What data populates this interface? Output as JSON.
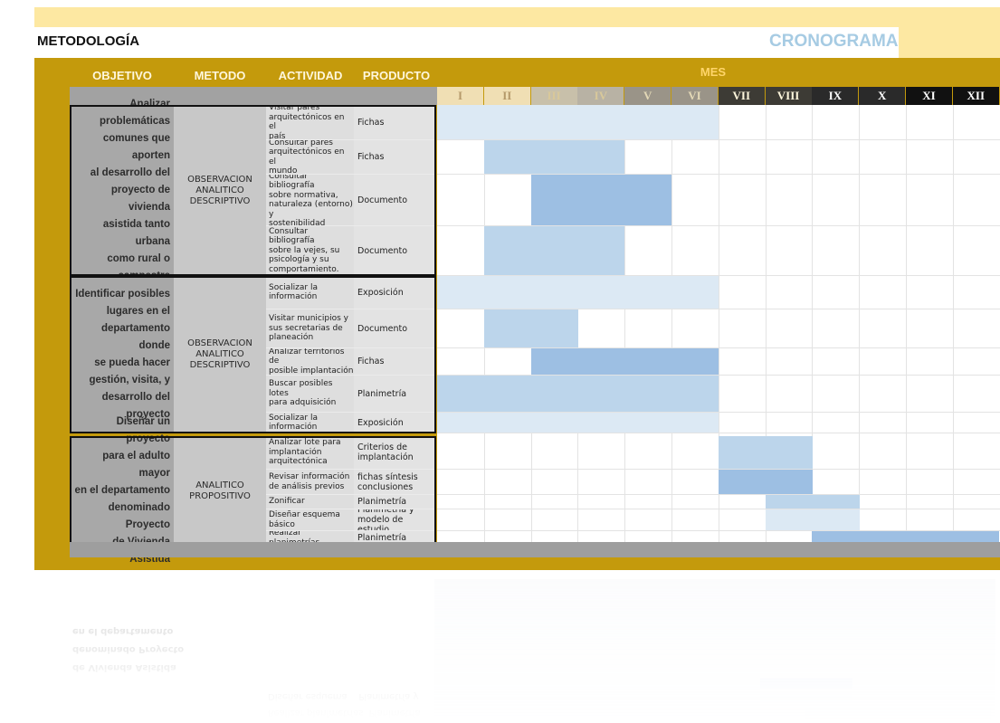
{
  "title_left": "METODOLOGÍA",
  "title_right": "CRONOGRAMA",
  "headers": {
    "objetivo": "OBJETIVO",
    "metodo": "METODO",
    "actividad": "ACTIVIDAD",
    "producto": "PRODUCTO",
    "mes": "MES"
  },
  "months": [
    "I",
    "II",
    "III",
    "IV",
    "V",
    "VI",
    "VII",
    "VIII",
    "IX",
    "X",
    "XI",
    "XII"
  ],
  "colors": {
    "sheet": "#c49a0c",
    "header_strip": "#fde8a2",
    "title_right": "#a6cbe3",
    "bar_light": "#dce9f4",
    "bar_mid": "#bcd5eb",
    "bar_dark": "#9dbfe3"
  },
  "sections": [
    {
      "objetivo": "Analizar\nproblemáticas\ncomunes que aporten\nal desarrollo del\nproyecto de vivienda\nasistida tanto urbana\ncomo rural o\ncampestre",
      "metodo": "OBSERVACION\nANALITICO\nDESCRIPTIVO",
      "rows": [
        {
          "actividad": "Visitar pares\narquitectónicos en el\npaís",
          "producto": "Fichas",
          "start": 1,
          "end": 6,
          "shade": "light"
        },
        {
          "actividad": "Consultar pares\narquitectónicos en el\nmundo",
          "producto": "Fichas",
          "start": 2,
          "end": 4,
          "shade": "mid"
        },
        {
          "actividad": "Consultar bibliografía\nsobre normativa,\nnaturaleza (entorno) y\nsostenibilidad",
          "producto": "Documento",
          "start": 3,
          "end": 5,
          "shade": "dark"
        },
        {
          "actividad": "Consultar bibliografía\nsobre la vejes, su\npsicología y su\ncomportamiento.",
          "producto": "Documento",
          "start": 2,
          "end": 4,
          "shade": "mid"
        }
      ]
    },
    {
      "objetivo": "Identificar posibles\nlugares en el\ndepartamento donde\nse pueda hacer\ngestión, visita, y\ndesarrollo del\nproyecto",
      "metodo": "OBSERVACION\nANALITICO\nDESCRIPTIVO",
      "rows": [
        {
          "actividad": "Socializar la\ninformación",
          "producto": "Exposición",
          "start": 1,
          "end": 6,
          "shade": "light"
        },
        {
          "actividad": "Visitar municipios y\nsus secretarias de\nplaneación",
          "producto": "Documento",
          "start": 2,
          "end": 3,
          "shade": "mid"
        },
        {
          "actividad": "Analizar territorios de\nposible implantación",
          "producto": "Fichas",
          "start": 3,
          "end": 6,
          "shade": "dark"
        },
        {
          "actividad": "Buscar posibles lotes\npara adquisición",
          "producto": "Planimetría",
          "start": 1,
          "end": 6,
          "shade": "mid"
        },
        {
          "actividad": "Socializar la\ninformación",
          "producto": "Exposición",
          "start": 1,
          "end": 6,
          "shade": "light"
        }
      ]
    },
    {
      "objetivo": "Diseñar un proyecto\npara el adulto mayor\nen el departamento\ndenominado Proyecto\nde Vivienda Asistida",
      "metodo": "ANALITICO\nPROPOSITIVO",
      "rows": [
        {
          "actividad": "Analizar lote para\nimplantación\narquitectónica",
          "producto": "Criterios de\nimplantación",
          "start": 7,
          "end": 8,
          "shade": "mid"
        },
        {
          "actividad": "Revisar información\nde análisis previos",
          "producto": "fichas síntesis\nconclusiones",
          "start": 7,
          "end": 8,
          "shade": "dark"
        },
        {
          "actividad": "Zonificar",
          "producto": "Planimetría",
          "start": 8,
          "end": 9,
          "shade": "mid"
        },
        {
          "actividad": "Diseñar esquema\nbásico",
          "producto": "Planimetría y\nmodelo de estudio",
          "start": 8,
          "end": 9,
          "shade": "light"
        },
        {
          "actividad": "Realizar planimetrías",
          "producto": "Planimetría",
          "start": 9,
          "end": 12,
          "shade": "dark"
        }
      ]
    }
  ]
}
